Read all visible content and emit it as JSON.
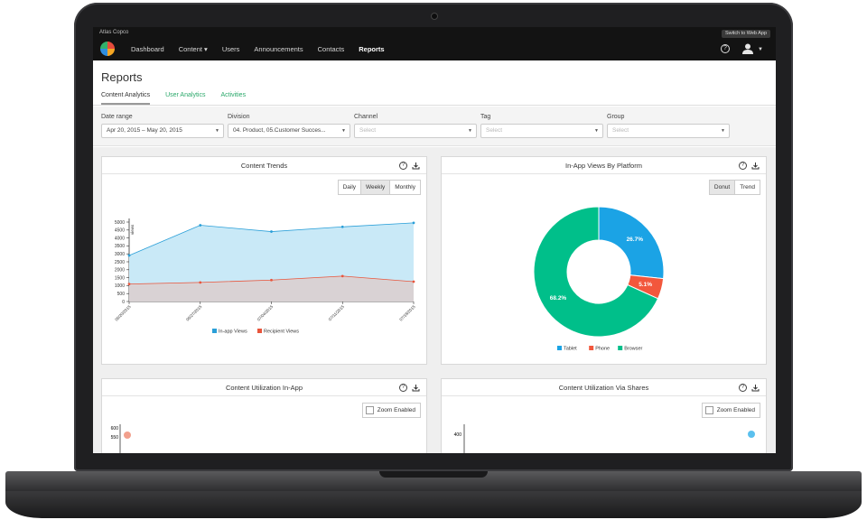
{
  "app": {
    "company": "Atlas Copco",
    "switch_label": "Switch to Web App",
    "nav": [
      "Dashboard",
      "Content ▾",
      "Users",
      "Announcements",
      "Contacts",
      "Reports"
    ],
    "help_label": "?"
  },
  "page": {
    "title": "Reports",
    "tabs": [
      "Content Analytics",
      "User Analytics",
      "Activities"
    ]
  },
  "filters": [
    {
      "label": "Date range",
      "value": "Apr 20, 2015 – May 20, 2015",
      "placeholder": false
    },
    {
      "label": "Division",
      "value": "04. Product, 05.Customer Succes...",
      "placeholder": false
    },
    {
      "label": "Channel",
      "value": "Select",
      "placeholder": true
    },
    {
      "label": "Tag",
      "value": "Select",
      "placeholder": true
    },
    {
      "label": "Group",
      "value": "Select",
      "placeholder": true
    }
  ],
  "panels": {
    "trends": {
      "title": "Content Trends",
      "buttons": [
        "Daily",
        "Weekly",
        "Monthly"
      ],
      "active": "Weekly"
    },
    "platform": {
      "title": "In-App Views By Platform",
      "buttons": [
        "Donut",
        "Trend"
      ],
      "active": "Donut"
    },
    "util_inapp": {
      "title": "Content Utilization In-App",
      "zoom_label": "Zoom Enabled"
    },
    "util_shares": {
      "title": "Content Utilization Via Shares",
      "zoom_label": "Zoom Enabled"
    }
  },
  "chart_data": [
    {
      "type": "area",
      "title": "Content Trends",
      "ylabel": "views",
      "ylim": [
        0,
        5000
      ],
      "yticks": [
        "0",
        "500",
        "1000",
        "1500",
        "2000",
        "2500",
        "3000",
        "3500",
        "4000",
        "4500",
        "5000"
      ],
      "xtick_labels": [
        "06/20/2015",
        "06/27/2015",
        "07/04/2015",
        "07/11/2015",
        "07/18/2015"
      ],
      "series": [
        {
          "name": "In-app Views",
          "color": "#2a9fd8",
          "values": [
            2900,
            4800,
            4400,
            4700,
            4950
          ]
        },
        {
          "name": "Recipient Views",
          "color": "#e8553c",
          "values": [
            1100,
            1200,
            1350,
            1600,
            1250
          ]
        }
      ],
      "legend": "bottom"
    },
    {
      "type": "pie",
      "title": "In-App Views By Platform",
      "donut": true,
      "slices": [
        {
          "name": "Tablet",
          "value": 26.7,
          "label": "26.7%",
          "color": "#1ba3e5"
        },
        {
          "name": "Phone",
          "value": 5.1,
          "label": "5.1%",
          "color": "#f2573c"
        },
        {
          "name": "Browser",
          "value": 68.2,
          "label": "68.2%",
          "color": "#00bf8a"
        }
      ],
      "legend": "bottom"
    }
  ],
  "util_axes": {
    "inapp_ticks": [
      "600",
      "550"
    ],
    "shares_ticks": [
      "400"
    ]
  },
  "colors": {
    "accent": "#2aa86a",
    "nav_bg": "#131313"
  }
}
